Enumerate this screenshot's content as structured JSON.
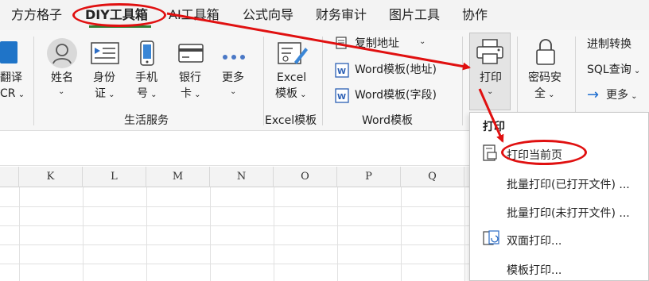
{
  "menubar": {
    "tabs": [
      {
        "label": "方方格子"
      },
      {
        "label": "DIY工具箱"
      },
      {
        "label": "AI工具箱"
      },
      {
        "label": "公式向导"
      },
      {
        "label": "财务审计"
      },
      {
        "label": "图片工具"
      },
      {
        "label": "协作"
      }
    ]
  },
  "ribbon": {
    "partial_left": {
      "line1": "翻译",
      "line2": "CR"
    },
    "life_group": {
      "buttons": [
        {
          "line1": "姓名",
          "line2": ""
        },
        {
          "line1": "身份",
          "line2": "证"
        },
        {
          "line1": "手机",
          "line2": "号"
        },
        {
          "line1": "银行",
          "line2": "卡"
        },
        {
          "line1": "更多",
          "line2": ""
        }
      ],
      "label": "生活服务"
    },
    "excel_group": {
      "line1": "Excel",
      "line2": "模板",
      "label": "Excel模板"
    },
    "word_group": {
      "items": [
        {
          "label": "复制地址"
        },
        {
          "label": "Word模板(地址)"
        },
        {
          "label": "Word模板(字段)"
        }
      ],
      "label": "Word模板"
    },
    "print_button": {
      "label": "打印"
    },
    "password_button": {
      "line1": "密码安",
      "line2": "全"
    },
    "right_items": [
      {
        "label": "进制转换"
      },
      {
        "label": "SQL查询"
      },
      {
        "label": "更多"
      }
    ]
  },
  "grid": {
    "columns": [
      "K",
      "L",
      "M",
      "N",
      "O",
      "P",
      "Q"
    ]
  },
  "print_menu": {
    "header": "打印",
    "items": [
      {
        "label": "打印当前页"
      },
      {
        "label": "批量打印(已打开文件) ..."
      },
      {
        "label": "批量打印(未打开文件) ..."
      },
      {
        "label": "双面打印..."
      },
      {
        "label": "模板打印..."
      }
    ]
  },
  "colors": {
    "annotation_red": "#e01010",
    "active_tab_underline": "#2f7d32",
    "word_blue": "#2b5fb4",
    "arrow_blue": "#1e6fd0"
  }
}
